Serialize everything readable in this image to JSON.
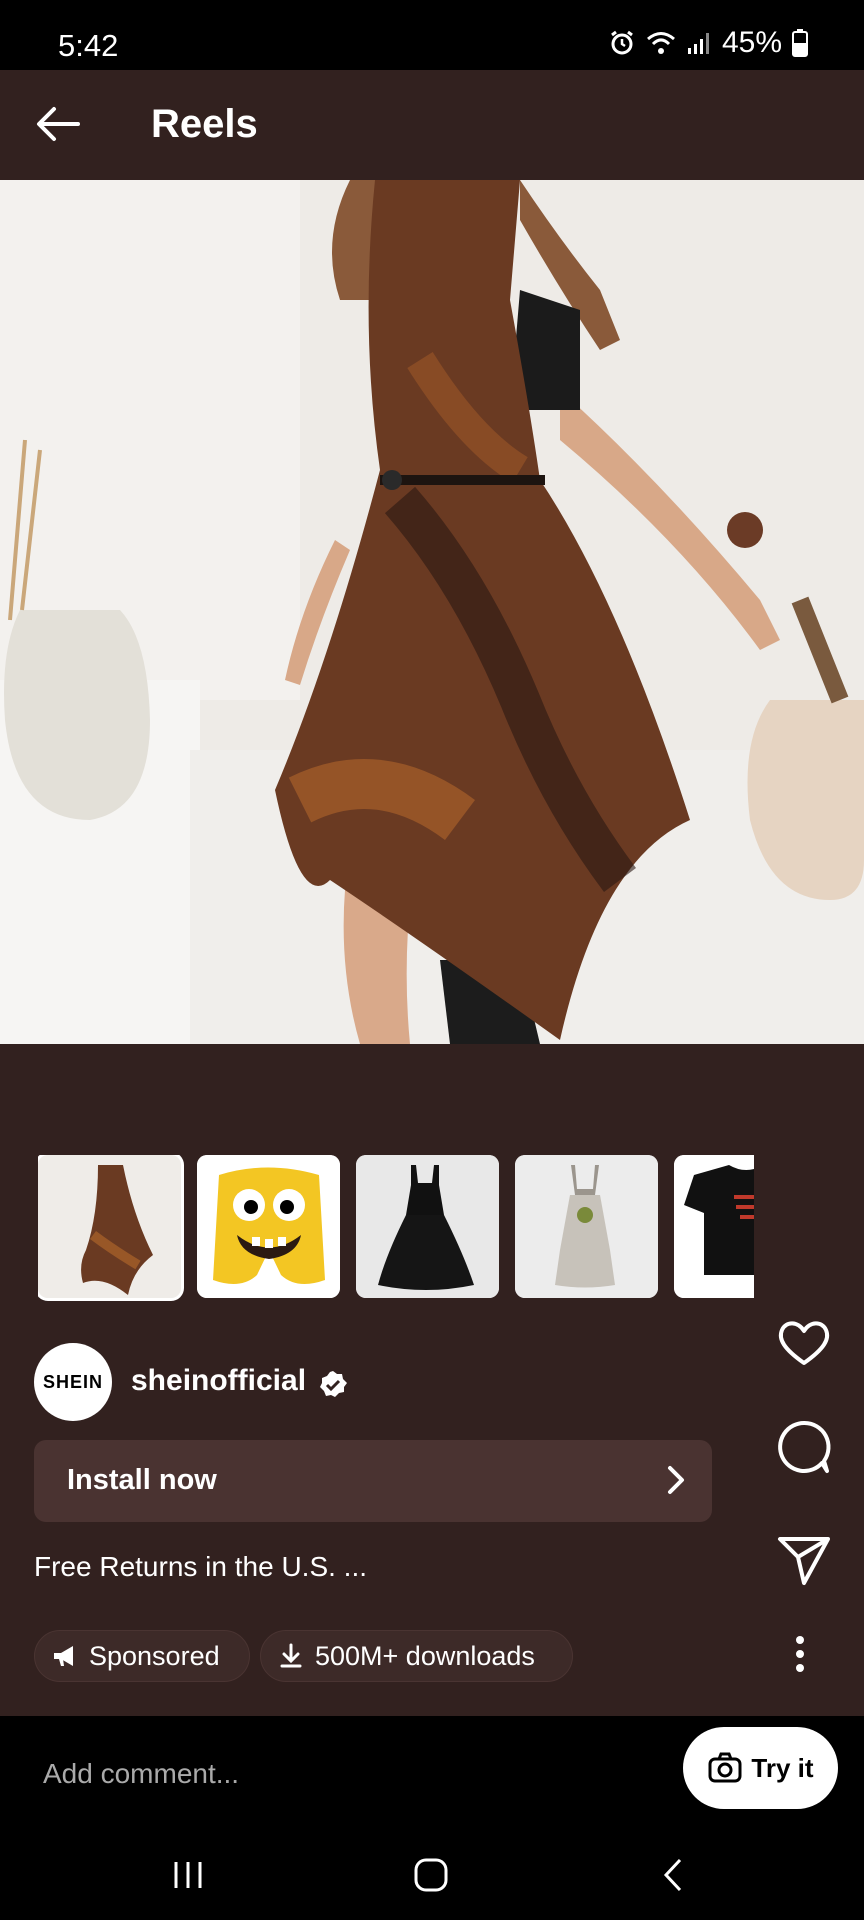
{
  "status_bar": {
    "time": "5:42",
    "battery": "45%"
  },
  "header": {
    "title": "Reels"
  },
  "post": {
    "brand_avatar_text": "SHEIN",
    "username": "sheinofficial",
    "install_label": "Install now",
    "caption": "Free Returns in the U.S. ...",
    "chips": {
      "sponsored": "Sponsored",
      "downloads": "500M+ downloads"
    }
  },
  "thumbnails": [
    {
      "name": "tie-dye-dress"
    },
    {
      "name": "yellow-face-shorts"
    },
    {
      "name": "black-lace-dress"
    },
    {
      "name": "grey-overall-dress"
    },
    {
      "name": "black-tshirt-red-text"
    }
  ],
  "comment": {
    "placeholder": "Add comment...",
    "try_it": "Try it"
  },
  "colors": {
    "background": "#32211f",
    "bar": "#000000",
    "install_bg": "#4a3331"
  }
}
